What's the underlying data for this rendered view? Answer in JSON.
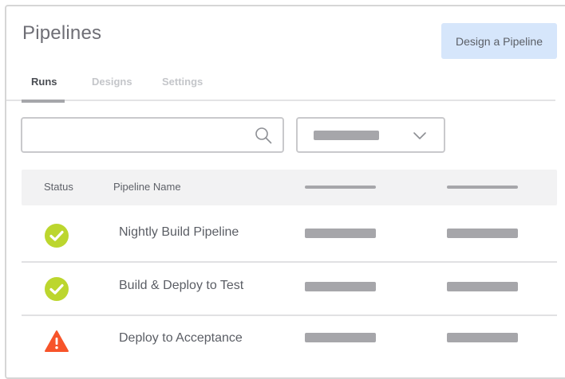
{
  "header": {
    "title": "Pipelines",
    "design_button_label": "Design a Pipeline"
  },
  "tabs": [
    {
      "label": "Runs",
      "active": true
    },
    {
      "label": "Designs",
      "active": false
    },
    {
      "label": "Settings",
      "active": false
    }
  ],
  "search": {
    "value": "",
    "icon": "search-icon"
  },
  "filter": {
    "icon": "chevron-down-icon"
  },
  "table": {
    "columns": [
      "Status",
      "Pipeline Name"
    ],
    "rows": [
      {
        "status": "success",
        "status_icon": "check-circle-icon",
        "name": "Nightly Build Pipeline"
      },
      {
        "status": "success",
        "status_icon": "check-circle-icon",
        "name": "Build & Deploy to Test"
      },
      {
        "status": "warning",
        "status_icon": "warning-triangle-icon",
        "name": "Deploy to Acceptance"
      }
    ]
  },
  "colors": {
    "success": "#bcd62e",
    "warning": "#f7542a",
    "primary_button_bg": "#d6e6fb",
    "placeholder_bar": "#a6a6aa"
  }
}
